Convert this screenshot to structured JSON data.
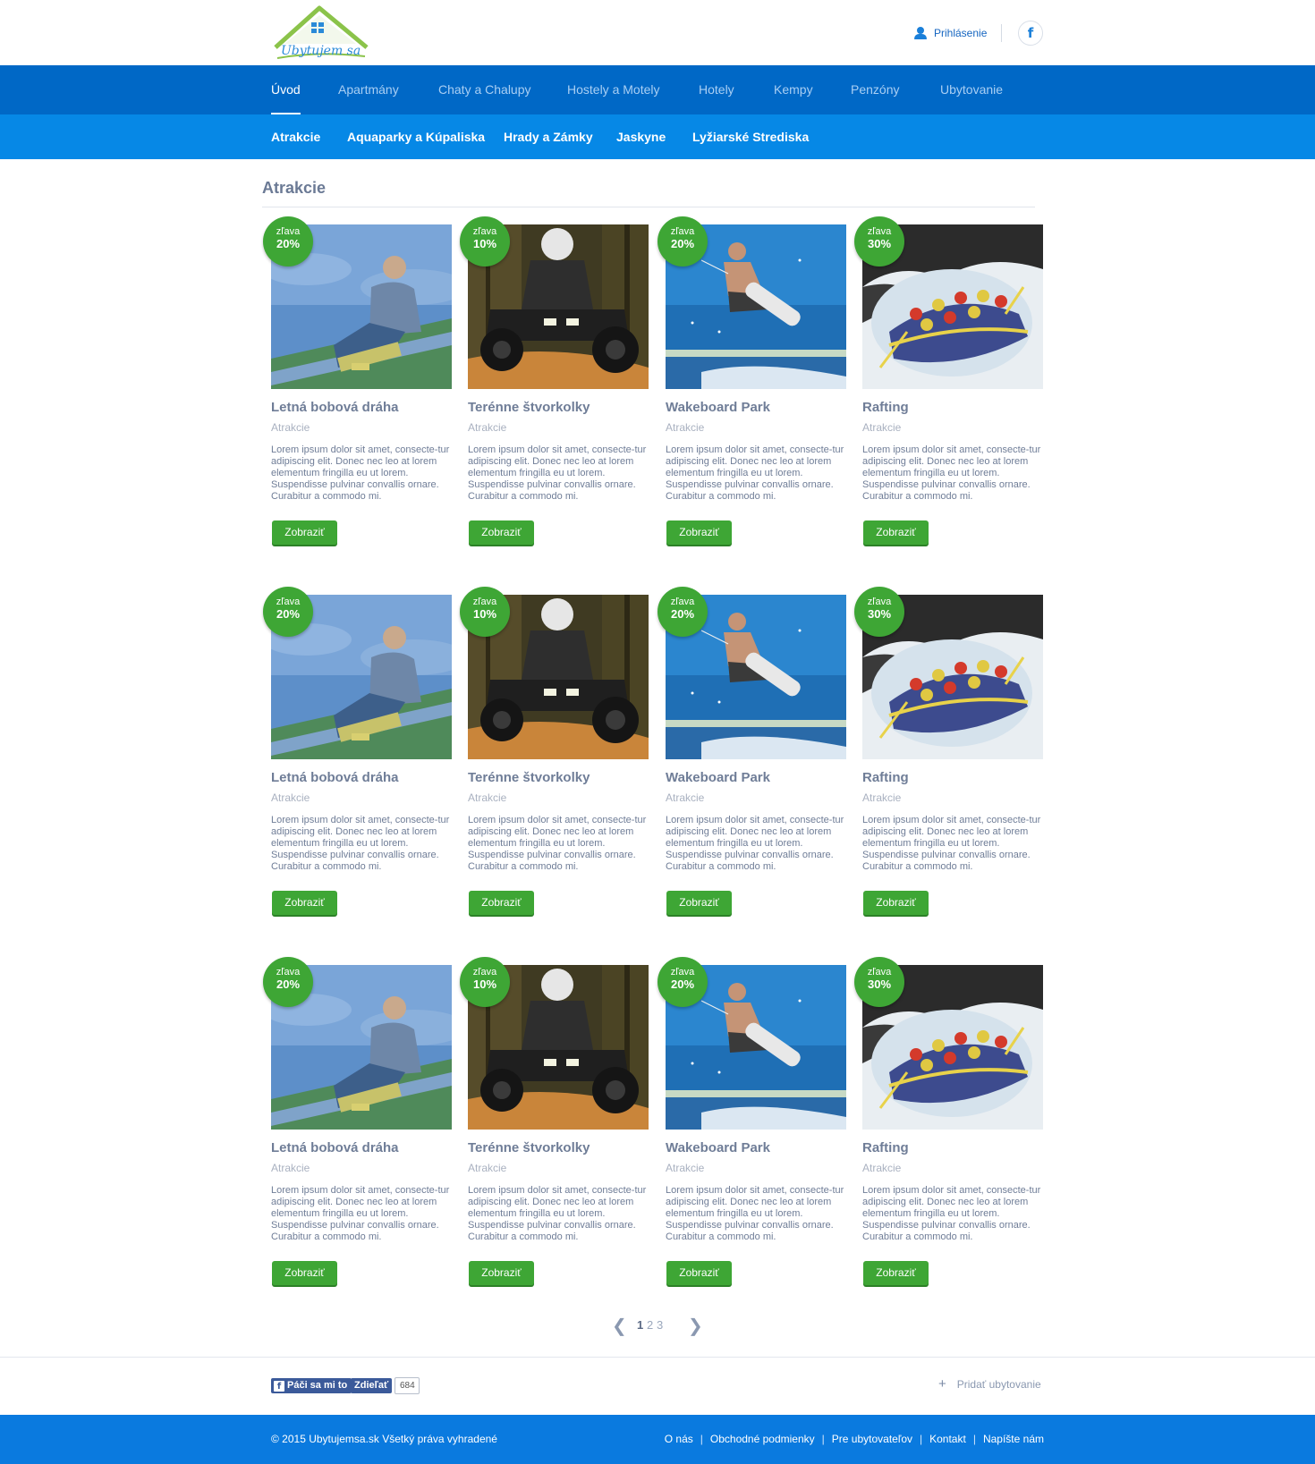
{
  "header": {
    "logo_text": "Ubytujem sa",
    "login_label": "Prihlásenie",
    "facebook_glyph": "f"
  },
  "main_nav": [
    {
      "label": "Úvod",
      "active": true
    },
    {
      "label": "Apartmány",
      "active": false
    },
    {
      "label": "Chaty a Chalupy",
      "active": false
    },
    {
      "label": "Hostely a Motely",
      "active": false
    },
    {
      "label": "Hotely",
      "active": false
    },
    {
      "label": "Kempy",
      "active": false
    },
    {
      "label": "Penzóny",
      "active": false
    },
    {
      "label": "Ubytovanie",
      "active": false
    }
  ],
  "sub_nav": [
    {
      "label": "Atrakcie"
    },
    {
      "label": "Aquaparky a Kúpaliska"
    },
    {
      "label": "Hrady a Zámky"
    },
    {
      "label": "Jaskyne"
    },
    {
      "label": "Lyžiarské Strediska"
    }
  ],
  "section_title": "Atrakcie",
  "discount_label": "zľava",
  "cards": [
    {
      "title": "Letná bobová dráha",
      "category": "Atrakcie",
      "discount": "20%",
      "image": "bobsled",
      "description": "Lorem ipsum dolor sit amet, consecte-tur adipiscing elit. Donec nec leo at lorem elementum fringilla eu ut lorem. Suspendisse pulvinar convallis ornare. Curabitur a commodo mi.",
      "button": "Zobraziť"
    },
    {
      "title": "Terénne štvorkolky",
      "category": "Atrakcie",
      "discount": "10%",
      "image": "quad",
      "description": "Lorem ipsum dolor sit amet, consecte-tur adipiscing elit. Donec nec leo at lorem elementum fringilla eu ut lorem. Suspendisse pulvinar convallis ornare. Curabitur a commodo mi.",
      "button": "Zobraziť"
    },
    {
      "title": "Wakeboard Park",
      "category": "Atrakcie",
      "discount": "20%",
      "image": "wakeboard",
      "description": "Lorem ipsum dolor sit amet, consecte-tur adipiscing elit. Donec nec leo at lorem elementum fringilla eu ut lorem. Suspendisse pulvinar convallis ornare. Curabitur a commodo mi.",
      "button": "Zobraziť"
    },
    {
      "title": "Rafting",
      "category": "Atrakcie",
      "discount": "30%",
      "image": "rafting",
      "description": "Lorem ipsum dolor sit amet, consecte-tur adipiscing elit. Donec nec leo at lorem elementum fringilla eu ut lorem. Suspendisse pulvinar convallis ornare. Curabitur a commodo mi.",
      "button": "Zobraziť"
    },
    {
      "title": "Letná bobová dráha",
      "category": "Atrakcie",
      "discount": "20%",
      "image": "bobsled",
      "description": "Lorem ipsum dolor sit amet, consecte-tur adipiscing elit. Donec nec leo at lorem elementum fringilla eu ut lorem. Suspendisse pulvinar convallis ornare. Curabitur a commodo mi.",
      "button": "Zobraziť"
    },
    {
      "title": "Terénne štvorkolky",
      "category": "Atrakcie",
      "discount": "10%",
      "image": "quad",
      "description": "Lorem ipsum dolor sit amet, consecte-tur adipiscing elit. Donec nec leo at lorem elementum fringilla eu ut lorem. Suspendisse pulvinar convallis ornare. Curabitur a commodo mi.",
      "button": "Zobraziť"
    },
    {
      "title": "Wakeboard Park",
      "category": "Atrakcie",
      "discount": "20%",
      "image": "wakeboard",
      "description": "Lorem ipsum dolor sit amet, consecte-tur adipiscing elit. Donec nec leo at lorem elementum fringilla eu ut lorem. Suspendisse pulvinar convallis ornare. Curabitur a commodo mi.",
      "button": "Zobraziť"
    },
    {
      "title": "Rafting",
      "category": "Atrakcie",
      "discount": "30%",
      "image": "rafting",
      "description": "Lorem ipsum dolor sit amet, consecte-tur adipiscing elit. Donec nec leo at lorem elementum fringilla eu ut lorem. Suspendisse pulvinar convallis ornare. Curabitur a commodo mi.",
      "button": "Zobraziť"
    },
    {
      "title": "Letná bobová dráha",
      "category": "Atrakcie",
      "discount": "20%",
      "image": "bobsled",
      "description": "Lorem ipsum dolor sit amet, consecte-tur adipiscing elit. Donec nec leo at lorem elementum fringilla eu ut lorem. Suspendisse pulvinar convallis ornare. Curabitur a commodo mi.",
      "button": "Zobraziť"
    },
    {
      "title": "Terénne štvorkolky",
      "category": "Atrakcie",
      "discount": "10%",
      "image": "quad",
      "description": "Lorem ipsum dolor sit amet, consecte-tur adipiscing elit. Donec nec leo at lorem elementum fringilla eu ut lorem. Suspendisse pulvinar convallis ornare. Curabitur a commodo mi.",
      "button": "Zobraziť"
    },
    {
      "title": "Wakeboard Park",
      "category": "Atrakcie",
      "discount": "20%",
      "image": "wakeboard",
      "description": "Lorem ipsum dolor sit amet, consecte-tur adipiscing elit. Donec nec leo at lorem elementum fringilla eu ut lorem. Suspendisse pulvinar convallis ornare. Curabitur a commodo mi.",
      "button": "Zobraziť"
    },
    {
      "title": "Rafting",
      "category": "Atrakcie",
      "discount": "30%",
      "image": "rafting",
      "description": "Lorem ipsum dolor sit amet, consecte-tur adipiscing elit. Donec nec leo at lorem elementum fringilla eu ut lorem. Suspendisse pulvinar convallis ornare. Curabitur a commodo mi.",
      "button": "Zobraziť"
    }
  ],
  "pagination": {
    "prev_glyph": "❮",
    "next_glyph": "❯",
    "pages": [
      "1",
      "2",
      "3"
    ],
    "current": "1"
  },
  "social": {
    "like_label": "Páči sa mi to",
    "share_label": "Zdieľať",
    "count": "684"
  },
  "add_lodging": {
    "icon": "plus-icon",
    "label": "Pridať ubytovanie"
  },
  "footer": {
    "copyright": "© 2015 Ubytujemsa.sk Všetký práva vyhradené",
    "links": [
      "O nás",
      "Obchodné podmienky",
      "Pre ubytovateľov",
      "Kontakt",
      "Napíšte nám"
    ]
  },
  "colors": {
    "nav_primary": "#0068c6",
    "nav_secondary": "#0688e6",
    "accent_green": "#3ea635",
    "footer_blue": "#0a7adf"
  }
}
